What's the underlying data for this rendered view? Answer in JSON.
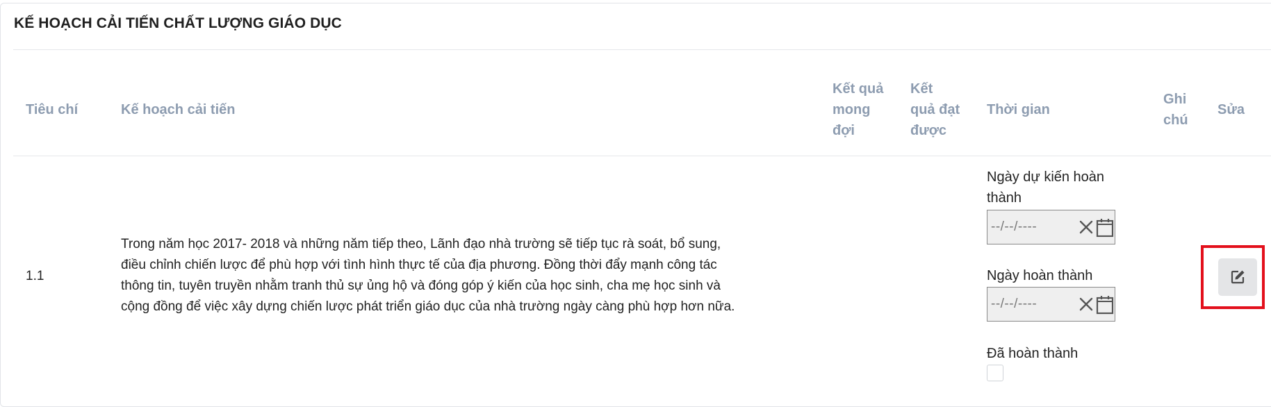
{
  "card": {
    "title": "KẾ HOẠCH CẢI TIẾN CHẤT LƯỢNG GIÁO DỤC"
  },
  "table": {
    "headers": {
      "criteria": "Tiêu chí",
      "plan": "Kế hoạch cải tiến",
      "expected_lines": [
        "Kết quả",
        "mong",
        "đợi"
      ],
      "achieved_lines": [
        "Kết",
        "quả đạt",
        "được"
      ],
      "time": "Thời gian",
      "note_lines": [
        "Ghi",
        "chú"
      ],
      "edit": "Sửa"
    },
    "rows": [
      {
        "criteria": "1.1",
        "plan_lines": [
          "Trong năm học 2017- 2018 và những năm tiếp theo, Lãnh đạo nhà trường sẽ tiếp tục rà soát, bổ sung,",
          "điều chỉnh chiến lược để phù hợp với tình hình thực tế của địa phương. Đồng thời đẩy mạnh công tác",
          "thông tin, tuyên truyền nhằm tranh thủ sự ủng hộ và đóng góp ý kiến của học sinh, cha mẹ học sinh và",
          "cộng đồng để việc xây dựng chiến lược phát triển giáo dục của nhà trường ngày càng phù hợp hơn nữa."
        ],
        "time": {
          "expected_label_lines": [
            "Ngày dự kiến hoàn",
            "thành"
          ],
          "completed_label": "Ngày hoàn thành",
          "date_placeholder": "--/--/----",
          "done_label": "Đã hoàn thành",
          "done_checked": false
        }
      }
    ]
  },
  "icons": {
    "clear": "close-x-icon",
    "calendar": "calendar-icon",
    "edit": "edit-pencil-square-icon"
  },
  "colors": {
    "header_text": "#8d9cb0",
    "highlight": "#e3101c",
    "edit_button_bg": "#e4e5e7"
  }
}
